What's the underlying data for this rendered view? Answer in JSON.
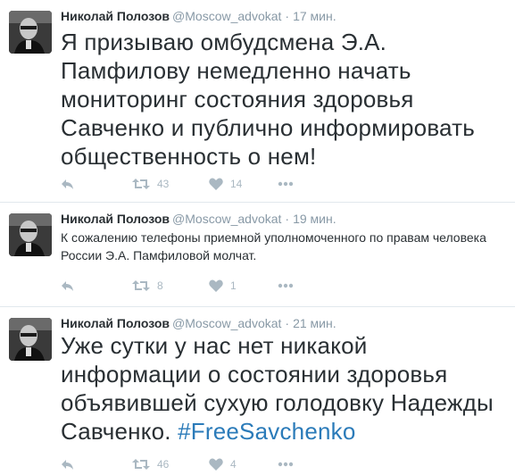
{
  "tweets": [
    {
      "name": "Николай Полозов",
      "handle": "@Moscow_advokat",
      "separator": "·",
      "time": "17 мин.",
      "text": "Я призываю омбудсмена Э.А. Памфилову немедленно начать мониторинг состояния здоровья Савченко и публично информировать общественность о нем!",
      "retweets": "43",
      "likes": "14"
    },
    {
      "name": "Николай Полозов",
      "handle": "@Moscow_advokat",
      "separator": "·",
      "time": "19 мин.",
      "text": "К сожалению телефоны приемной уполномоченного по правам человека России Э.А. Памфиловой молчат.",
      "retweets": "8",
      "likes": "1"
    },
    {
      "name": "Николай Полозов",
      "handle": "@Moscow_advokat",
      "separator": "·",
      "time": "21 мин.",
      "text": "Уже сутки у нас нет никакой информации о состоянии здоровья объявившей сухую голодовку Надежды Савченко.",
      "hashtag": "#FreeSavchenko",
      "retweets": "46",
      "likes": "4"
    }
  ],
  "icons": {
    "reply": "reply-arrow-icon",
    "retweet": "retweet-icon",
    "like": "heart-icon",
    "more": "more-dots-icon"
  },
  "colors": {
    "name": "#292f33",
    "meta": "#8899a6",
    "action": "#aab8c2",
    "hashtag": "#2b7bb9",
    "divider": "#e1e8ed"
  }
}
